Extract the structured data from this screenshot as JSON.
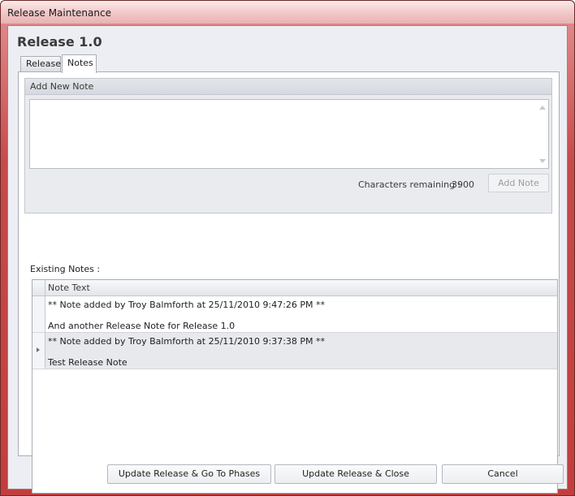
{
  "window": {
    "title": "Release Maintenance"
  },
  "page": {
    "title": "Release 1.0"
  },
  "tabs": [
    {
      "label": "Release",
      "active": false
    },
    {
      "label": "Notes",
      "active": true
    }
  ],
  "add_note": {
    "header": "Add New Note",
    "text_value": "",
    "chars_label": "Characters remaining :",
    "chars_value": "3900",
    "button_label": "Add Note"
  },
  "existing": {
    "label": "Existing Notes :",
    "column_header": "Note Text",
    "rows": [
      {
        "line1": "** Note added by Troy Balmforth at 25/11/2010 9:47:26 PM **",
        "line2": "And another Release Note for Release 1.0",
        "selected": false
      },
      {
        "line1": "** Note added by Troy Balmforth at 25/11/2010 9:37:38 PM **",
        "line2": "Test Release Note",
        "selected": true
      }
    ]
  },
  "footer": {
    "phases_label": "Update Release & Go To Phases",
    "update_close_label": "Update Release & Close",
    "cancel_label": "Cancel"
  },
  "colors": {
    "frame": "#c74a4a",
    "client": "#eceef3",
    "selected_row": "#e8e9ec"
  }
}
